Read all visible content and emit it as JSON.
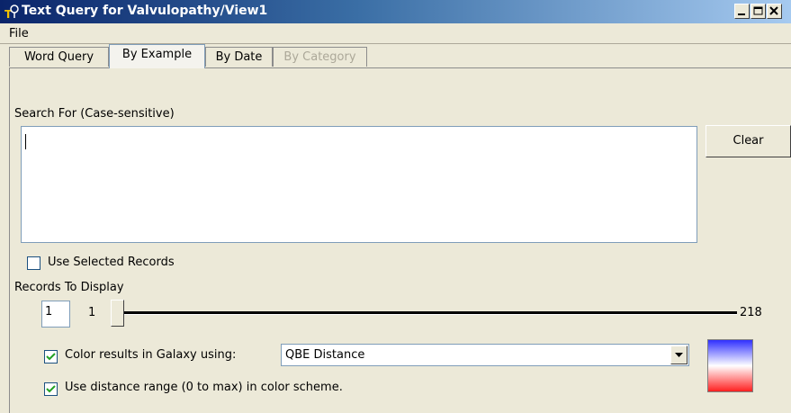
{
  "window": {
    "title": "Text Query for Valvulopathy/View1",
    "icons": {
      "app": "query-app-icon",
      "minimize": "minimize-icon",
      "maximize": "maximize-icon",
      "close": "close-icon"
    }
  },
  "menu": {
    "file": "File"
  },
  "tabs": [
    {
      "label": "Word Query",
      "state": "normal"
    },
    {
      "label": "By Example",
      "state": "active"
    },
    {
      "label": "By Date",
      "state": "normal"
    },
    {
      "label": "By Category",
      "state": "disabled"
    }
  ],
  "search": {
    "label": "Search For (Case-sensitive)",
    "value": ""
  },
  "clear_button": "Clear",
  "use_selected": {
    "label": "Use Selected Records",
    "checked": false
  },
  "records": {
    "label": "Records To Display",
    "spin_value": "1",
    "min_label": "1",
    "max_label": "218",
    "slider_value": 1
  },
  "color_results": {
    "label": "Color results in Galaxy using:",
    "checked": true
  },
  "color_scheme": {
    "selected": "QBE Distance"
  },
  "distance_range": {
    "label": "Use distance range (0 to max) in color scheme.",
    "checked": true
  },
  "colors": {
    "title_start": "#0a246a",
    "title_end": "#a6caf0",
    "scale_top": "#3030ff",
    "scale_mid": "#ffffff",
    "scale_bottom": "#ff2020"
  }
}
